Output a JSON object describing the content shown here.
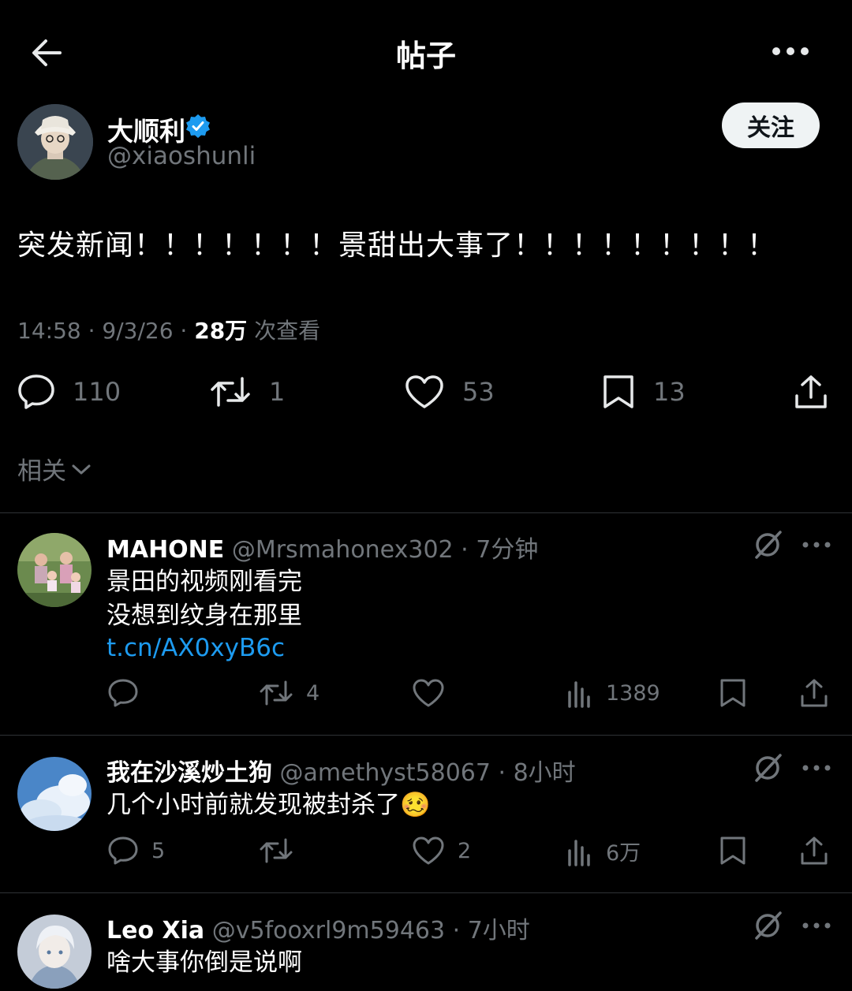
{
  "header": {
    "title": "帖子"
  },
  "post": {
    "author_name": "大顺利",
    "author_handle": "@xiaoshunli",
    "follow_label": "关注",
    "text": "突发新闻！！！！！！！景甜出大事了！！！！！！！！！",
    "time": "14:58 · 9/3/26 · ",
    "views": "28万",
    "views_suffix": " 次查看",
    "stats": {
      "replies": "110",
      "reposts": "1",
      "likes": "53",
      "bookmarks": "13"
    },
    "related_label": "相关"
  },
  "replies": [
    {
      "name": "MAHONE",
      "handle": "@Mrsmahonex302",
      "time": " · 7分钟",
      "lines": [
        "景田的视频刚看完",
        "没想到纹身在那里"
      ],
      "link": "t.cn/AX0xyB6c",
      "stats": {
        "replies": "",
        "reposts": "4",
        "likes": "",
        "views": "1389"
      }
    },
    {
      "name": "我在沙溪炒土狗",
      "handle": "@amethyst58067",
      "time": " · 8小时",
      "lines": [
        "几个小时前就发现被封杀了🥴"
      ],
      "stats": {
        "replies": "5",
        "reposts": "",
        "likes": "2",
        "views": "6万"
      }
    },
    {
      "name": "Leo Xia",
      "handle": "@v5fooxrl9m59463",
      "time": " · 7小时",
      "lines": [
        "啥大事你倒是说啊"
      ]
    }
  ],
  "colors": {
    "background": "#000000",
    "muted": "#71767b",
    "link": "#1d9bf0",
    "verified": "#1d9bf0"
  },
  "icons": [
    "back-arrow-icon",
    "more-icon",
    "verified-badge-icon",
    "reply-icon",
    "repost-icon",
    "like-icon",
    "bookmark-icon",
    "share-icon",
    "views-icon",
    "grok-icon",
    "chevron-down-icon"
  ]
}
